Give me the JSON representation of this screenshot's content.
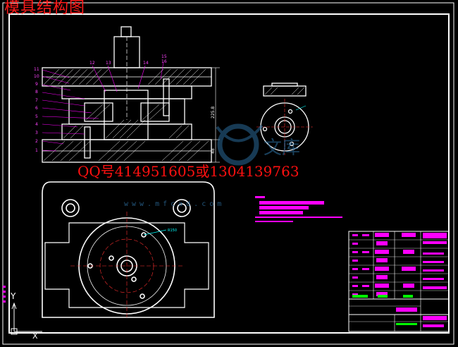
{
  "drawing_title": "模具结构图",
  "watermark_contact": "QQ号414951605或1304139763",
  "watermark_url": "www.mfcad.com",
  "watermark_brand": "文库",
  "ucs_axes": {
    "y_label": "Y",
    "x_label": "X"
  },
  "part_numbers": [
    "1",
    "2",
    "3",
    "4",
    "5",
    "6",
    "7",
    "8",
    "9",
    "10",
    "11",
    "12",
    "13",
    "14",
    "15",
    "16"
  ],
  "dimension_labels": {
    "total_height": "225.8",
    "small_height": "48",
    "diameter_note": "R150"
  },
  "colors": {
    "background": "#000000",
    "frame": "#ffffff",
    "title_red": "#ff1a1a",
    "magenta": "#ff00ff",
    "cyan": "#00ffff",
    "green": "#00ff00",
    "blue": "#3b6cff",
    "watermark": "#2a6a9a",
    "red_line": "#ff3030"
  }
}
